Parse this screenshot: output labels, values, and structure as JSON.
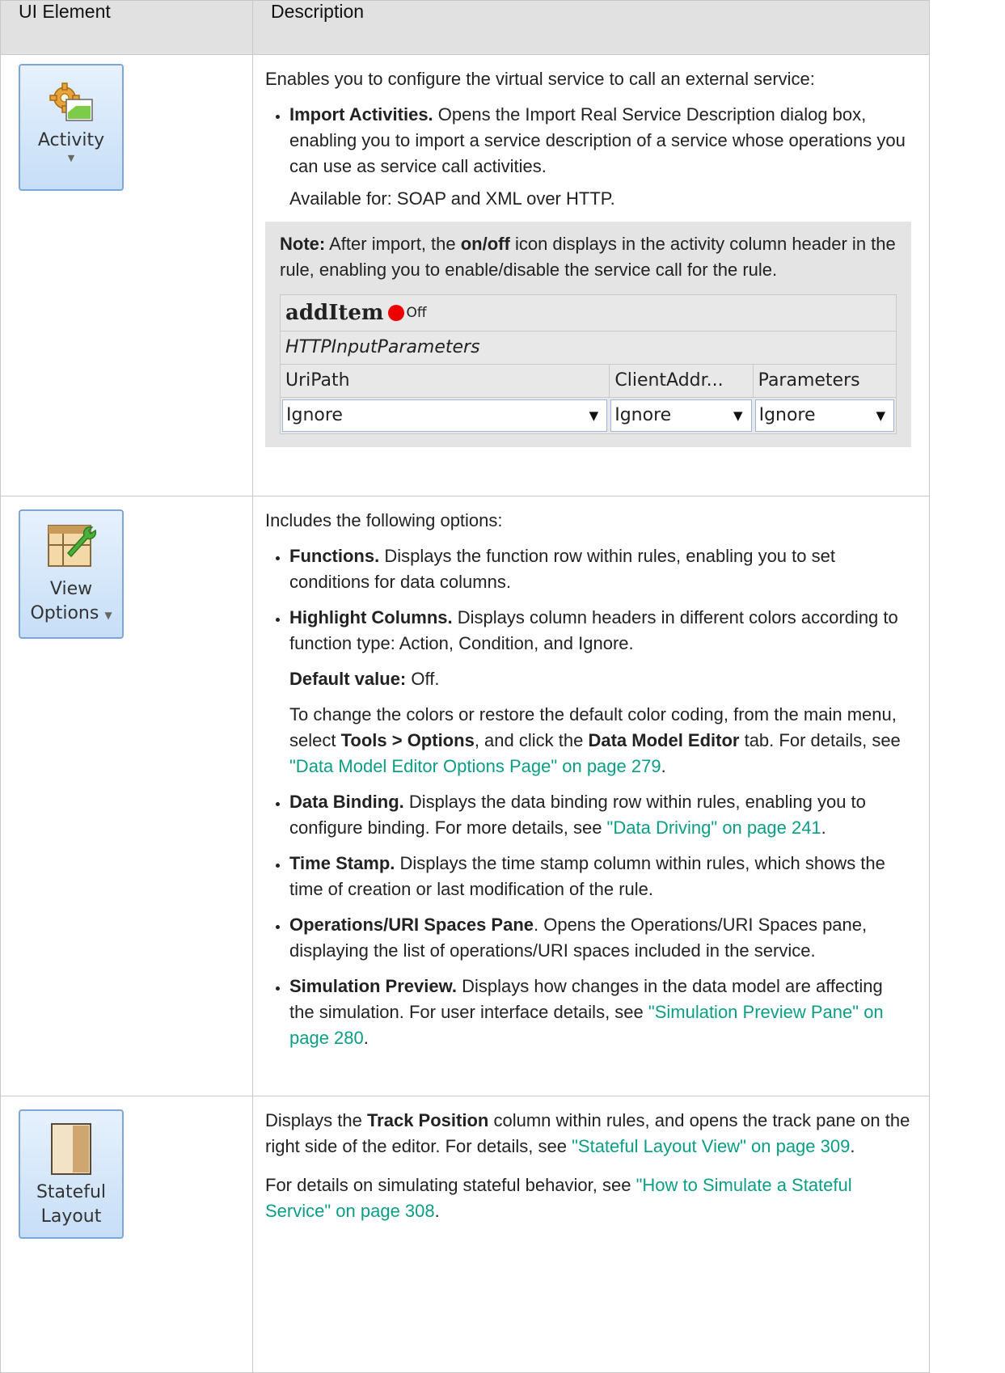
{
  "table": {
    "headers": {
      "ui_element": "UI Element",
      "description": "Description"
    },
    "rows": [
      {
        "button": {
          "label": "Activity",
          "icon": "gear-activity-icon"
        },
        "intro": "Enables you to configure the virtual service to call an external service:",
        "bullet_title": "Import Activities.",
        "bullet_text": " Opens the Import Real Service Description dialog box, enabling you to import a service description of a service whose operations you can use as service call activities.",
        "available": "Available for: SOAP and XML over HTTP.",
        "note": {
          "label": "Note:",
          "text_1": " After import, the ",
          "bold": "on/off",
          "text_2": " icon displays in the activity column header in the rule, enabling you to enable/disable the service call for the rule."
        },
        "grid": {
          "title": "addItem",
          "status": "Off",
          "status_color": "#ee0000",
          "subtitle": "HTTPInputParameters",
          "columns": [
            "UriPath",
            "ClientAddr...",
            "Parameters"
          ],
          "values": [
            "Ignore",
            "Ignore",
            "Ignore"
          ]
        }
      },
      {
        "button": {
          "label_line1": "View",
          "label_line2": "Options",
          "icon": "view-options-wrench-icon"
        },
        "intro": "Includes the following options:",
        "items": [
          {
            "title": "Functions.",
            "text": " Displays the function row within rules, enabling you to set conditions for data columns."
          },
          {
            "title": "Highlight Columns.",
            "text": " Displays column headers in different colors according to function type: Action, Condition, and Ignore."
          },
          {
            "title": "Data Binding.",
            "text": " Displays the data binding row within rules, enabling you to configure binding. For more details, see ",
            "link": "\"Data Driving\" on page 241",
            "after": "."
          },
          {
            "title": "Time Stamp.",
            "text": " Displays the time stamp column within rules, which shows the time of creation or last modification of the rule."
          },
          {
            "title": "Operations/URI Spaces Pane",
            "text": ". Opens the Operations/URI Spaces pane, displaying the list of operations/URI spaces included in the service."
          },
          {
            "title": "Simulation Preview.",
            "text": " Displays how changes in the data model are affecting the simulation. For user interface details, see ",
            "link": "\"Simulation Preview Pane\" on page 280",
            "after": "."
          }
        ],
        "default_label": "Default value:",
        "default_value": " Off.",
        "colors_text_1": "To change the colors or restore the default color coding, from the main menu, select ",
        "colors_bold_1": "Tools > Options",
        "colors_text_2": ", and click the ",
        "colors_bold_2": "Data Model Editor",
        "colors_text_3": " tab. For details, see ",
        "colors_link": "\"Data Model Editor Options Page\" on page 279",
        "colors_after": "."
      },
      {
        "button": {
          "label_line1": "Stateful",
          "label_line2": "Layout",
          "icon": "stateful-layout-icon"
        },
        "p1_text_1": "Displays the ",
        "p1_bold": "Track Position",
        "p1_text_2": " column within rules, and opens the track pane on the right side of the editor. For details, see ",
        "p1_link": "\"Stateful Layout View\" on page 309",
        "p1_after": ".",
        "p2_text": "For details on simulating stateful behavior, see ",
        "p2_link": "\"How to Simulate a Stateful Service\" on page 308",
        "p2_after": "."
      }
    ]
  },
  "colors": {
    "link": "#0b9e86",
    "header_bg": "#e1e1e1",
    "note_bg": "#e4e4e4"
  }
}
